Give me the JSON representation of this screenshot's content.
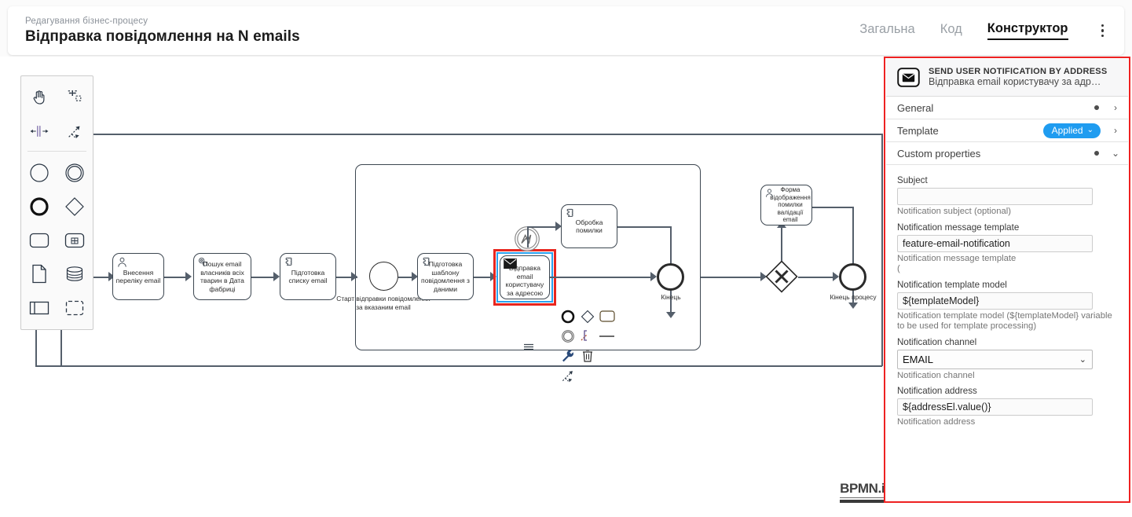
{
  "header": {
    "breadcrumb": "Редагування бізнес-процесу",
    "title": "Відправка повідомлення на N emails",
    "tabs": [
      {
        "label": "Загальна",
        "active": false
      },
      {
        "label": "Код",
        "active": false
      },
      {
        "label": "Конструктор",
        "active": true
      }
    ],
    "menu_icon": "kebab-menu-icon"
  },
  "palette": {
    "tools": [
      {
        "name": "hand-tool-icon",
        "title": "Activate the hand tool"
      },
      {
        "name": "lasso-tool-icon",
        "title": "Activate the lasso tool"
      },
      {
        "name": "space-tool-icon",
        "title": "Activate the create/remove space tool"
      },
      {
        "name": "global-connect-tool-icon",
        "title": "Activate the global connect tool"
      }
    ],
    "elements": [
      {
        "name": "start-event-icon",
        "title": "Create StartEvent"
      },
      {
        "name": "intermediate-event-icon",
        "title": "Create Intermediate/Boundary Event"
      },
      {
        "name": "end-event-icon",
        "title": "Create EndEvent"
      },
      {
        "name": "gateway-icon",
        "title": "Create Gateway"
      },
      {
        "name": "task-icon",
        "title": "Create Task"
      },
      {
        "name": "subprocess-collapsed-icon",
        "title": "Create collapsed Sub-process"
      },
      {
        "name": "data-object-icon",
        "title": "Create DataObjectReference"
      },
      {
        "name": "data-store-icon",
        "title": "Create DataStoreReference"
      },
      {
        "name": "participant-icon",
        "title": "Create Pool/Participant"
      },
      {
        "name": "group-icon",
        "title": "Create Group"
      }
    ]
  },
  "diagram": {
    "watermark": "BPMN.iO",
    "tasks": [
      {
        "id": "t1",
        "label": "Внесення переліку email",
        "icon": "user-task-icon"
      },
      {
        "id": "t2",
        "label": "Пошук email власників всіх тварин в Дата фабриці",
        "icon": "service-task-icon"
      },
      {
        "id": "t3",
        "label": "Підготовка списку email",
        "icon": "script-task-icon"
      },
      {
        "id": "t4",
        "label": "Підготовка шаблону повідомлення з даними",
        "icon": "script-task-icon"
      },
      {
        "id": "t5",
        "label": "Відправка email користувачу за адресою",
        "icon": "send-task-icon",
        "selected": true
      },
      {
        "id": "t6",
        "label": "Обробка помилки",
        "icon": "script-task-icon"
      },
      {
        "id": "t7",
        "label": "Форма відображення помилки валідації email",
        "icon": "user-task-icon"
      }
    ],
    "events": [
      {
        "id": "e1",
        "label": "Старт відправки повідомлення за вказаним email",
        "type": "start"
      },
      {
        "id": "e2",
        "label": "Кінець",
        "type": "end"
      },
      {
        "id": "e3",
        "label": "Кінець процесу",
        "type": "end"
      }
    ],
    "gateway": {
      "id": "g1",
      "marker": "X",
      "type": "exclusive-gateway"
    },
    "boundary_event": {
      "id": "b1",
      "type": "error-boundary-event"
    },
    "subprocess_marker": "expanded-subprocess-marker",
    "context_pad": [
      {
        "name": "append-end-event-icon"
      },
      {
        "name": "append-gateway-icon"
      },
      {
        "name": "append-task-icon"
      },
      {
        "name": "append-intermediate-event-icon"
      },
      {
        "name": "append-text-annotation-icon"
      },
      {
        "name": "connect-icon"
      },
      {
        "name": "change-type-wrench-icon"
      },
      {
        "name": "delete-trash-icon"
      },
      {
        "name": "global-connect-icon"
      }
    ]
  },
  "properties_panel": {
    "element": {
      "icon": "send-task-envelope-icon",
      "template_name": "SEND USER NOTIFICATION BY ADDRESS",
      "element_name": "Відправка email користувачу за адр…"
    },
    "groups": [
      {
        "label": "General",
        "marker": "dot",
        "chevron": "›",
        "expanded": false
      },
      {
        "label": "Template",
        "badge": "Applied",
        "badge_chevron": "⌄",
        "chevron": "›",
        "expanded": false
      },
      {
        "label": "Custom properties",
        "marker": "dot",
        "chevron": "⌄",
        "expanded": true
      }
    ],
    "fields": [
      {
        "label": "Subject",
        "type": "text",
        "value": "",
        "placeholder": "",
        "help": "Notification subject (optional)"
      },
      {
        "label": "Notification message template",
        "type": "text",
        "value": "feature-email-notification",
        "placeholder": "",
        "help": "Notification message template\n("
      },
      {
        "label": "Notification template model",
        "type": "text",
        "value": "${templateModel}",
        "placeholder": "",
        "help": "Notification template model (${templateModel} variable to be used for template processing)"
      },
      {
        "label": "Notification channel",
        "type": "select",
        "value": "EMAIL",
        "options": [
          "EMAIL"
        ],
        "help": "Notification channel"
      },
      {
        "label": "Notification address",
        "type": "text",
        "value": "${addressEl.value()}",
        "placeholder": "",
        "help": "Notification address"
      }
    ]
  },
  "colors": {
    "accent_blue": "#1f9cf0",
    "highlight_red": "#ee2222",
    "selection_blue": "#2aa2ef",
    "text_dark": "#1b1b1b",
    "text_muted": "#9aa0a6"
  }
}
